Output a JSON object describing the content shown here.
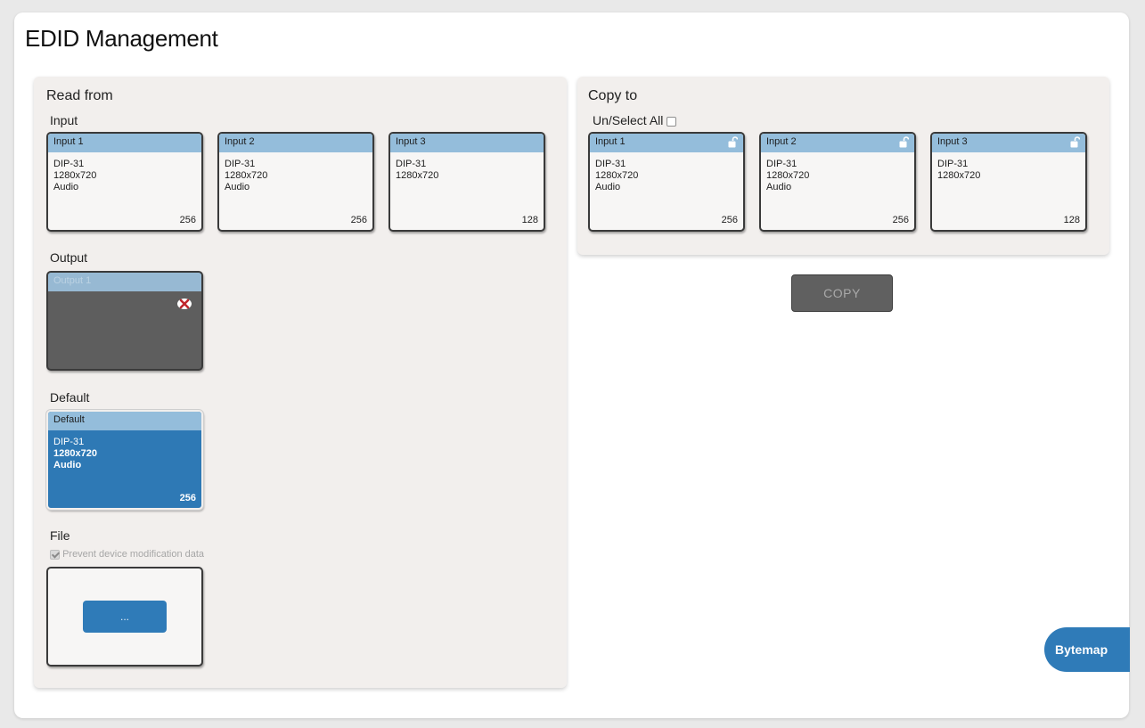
{
  "page": {
    "title": "EDID Management"
  },
  "read_from": {
    "title": "Read from",
    "input_label": "Input",
    "inputs": [
      {
        "name": "Input 1",
        "lines": [
          "DIP-31",
          "1280x720",
          "Audio"
        ],
        "size": "256"
      },
      {
        "name": "Input 2",
        "lines": [
          "DIP-31",
          "1280x720",
          "Audio"
        ],
        "size": "256"
      },
      {
        "name": "Input 3",
        "lines": [
          "DIP-31",
          "1280x720"
        ],
        "size": "128"
      }
    ],
    "output_label": "Output",
    "output": {
      "name": "Output 1",
      "status_icon": "error-x-icon"
    },
    "default_label": "Default",
    "default": {
      "name": "Default",
      "lines": [
        "DIP-31",
        "1280x720",
        "Audio"
      ],
      "size": "256",
      "selected": true
    },
    "file_label": "File",
    "prevent_label": "Prevent device modification data",
    "prevent_checked": true,
    "browse_label": "..."
  },
  "copy_to": {
    "title": "Copy to",
    "select_all_label": "Un/Select All",
    "select_all_checked": false,
    "targets": [
      {
        "name": "Input 1",
        "lines": [
          "DIP-31",
          "1280x720",
          "Audio"
        ],
        "size": "256",
        "icon": "unlock-icon"
      },
      {
        "name": "Input 2",
        "lines": [
          "DIP-31",
          "1280x720",
          "Audio"
        ],
        "size": "256",
        "icon": "unlock-icon"
      },
      {
        "name": "Input 3",
        "lines": [
          "DIP-31",
          "1280x720"
        ],
        "size": "128",
        "icon": "unlock-icon"
      }
    ]
  },
  "copy_button": "COPY",
  "bytemap_button": "Bytemap",
  "colors": {
    "accent": "#2f7bb8",
    "card_header": "#94bddb",
    "panel_bg": "#f2efed",
    "disabled_card": "#5e5e5e"
  }
}
